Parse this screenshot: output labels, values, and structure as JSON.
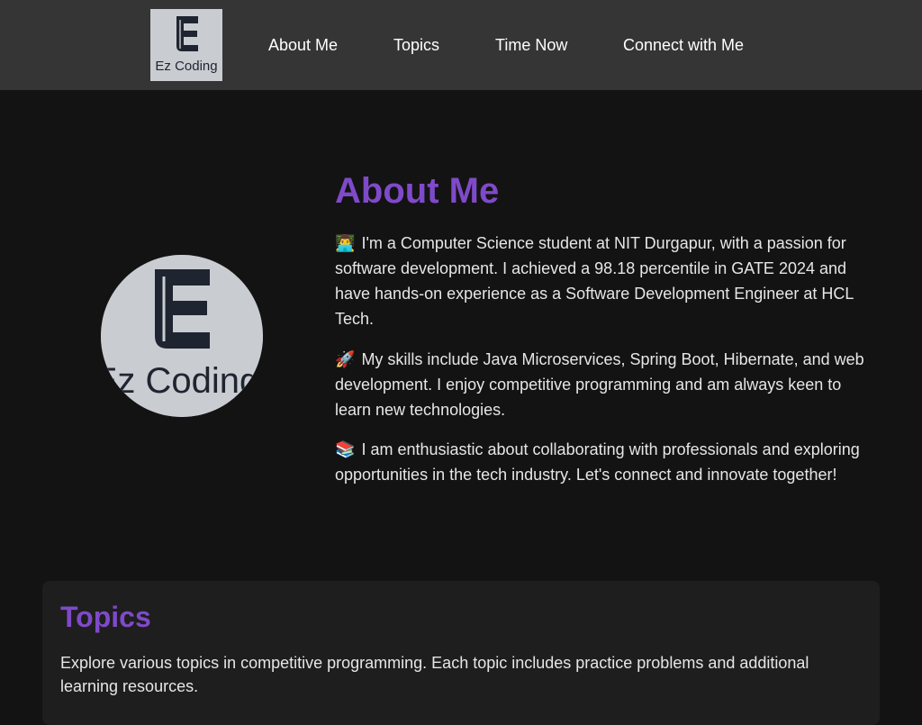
{
  "nav": {
    "logo_text": "Ez Coding",
    "links": [
      {
        "label": "About Me"
      },
      {
        "label": "Topics"
      },
      {
        "label": "Time Now"
      },
      {
        "label": "Connect with Me"
      }
    ]
  },
  "about": {
    "title": "About Me",
    "avatar_text": "Ez Coding",
    "paragraphs": [
      {
        "emoji": "👨‍💻",
        "text": "I'm a Computer Science student at NIT Durgapur, with a passion for software development. I achieved a 98.18 percentile in GATE 2024 and have hands-on experience as a Software Development Engineer at HCL Tech."
      },
      {
        "emoji": "🚀",
        "text": "My skills include Java Microservices, Spring Boot, Hibernate, and web development. I enjoy competitive programming and am always keen to learn new technologies."
      },
      {
        "emoji": "📚",
        "text": "I am enthusiastic about collaborating with professionals and exploring opportunities in the tech industry. Let's connect and innovate together!"
      }
    ]
  },
  "topics": {
    "title": "Topics",
    "description": "Explore various topics in competitive programming. Each topic includes practice problems and additional learning resources."
  },
  "colors": {
    "page_background": "#131313",
    "navbar_background": "#353535",
    "accent": "#7f4ac9",
    "card_background": "#1e1e1e",
    "logo_background": "#c9ccd1",
    "logo_ink": "#1f2530"
  }
}
